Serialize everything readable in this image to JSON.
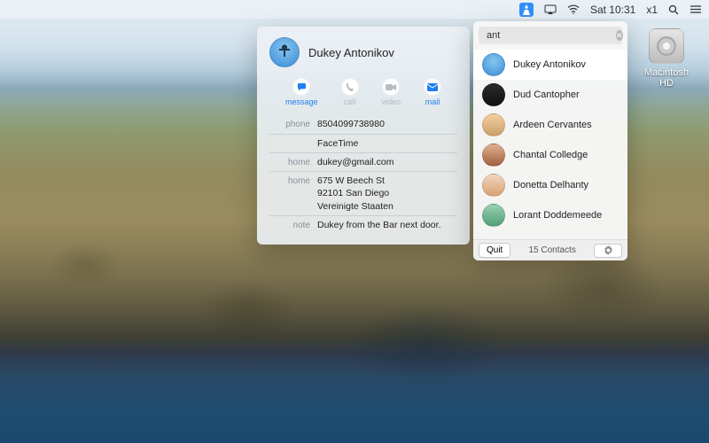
{
  "menubar": {
    "clock": "Sat 10:31",
    "x_label": "x1"
  },
  "drive": {
    "label": "Macintosh HD"
  },
  "list": {
    "search_value": "ant",
    "items": [
      {
        "name": "Dukey Antonikov"
      },
      {
        "name": "Dud Cantopher"
      },
      {
        "name": "Ardeen Cervantes"
      },
      {
        "name": "Chantal Colledge"
      },
      {
        "name": "Donetta Delhanty"
      },
      {
        "name": "Lorant Doddemeede"
      }
    ],
    "quit_label": "Quit",
    "count_label": "15 Contacts"
  },
  "card": {
    "name": "Dukey Antonikov",
    "actions": {
      "message": "message",
      "call": "call",
      "video": "video",
      "mail": "mail"
    },
    "fields": [
      {
        "label": "phone",
        "value": "8504099738980"
      },
      {
        "label": "",
        "value": "FaceTime"
      },
      {
        "label": "home",
        "value": "dukey@gmail.com"
      },
      {
        "label": "home",
        "value": "675 W Beech St\n92101 San Diego\nVereinigte Staaten"
      },
      {
        "label": "note",
        "value": "Dukey from the Bar next door."
      }
    ]
  }
}
